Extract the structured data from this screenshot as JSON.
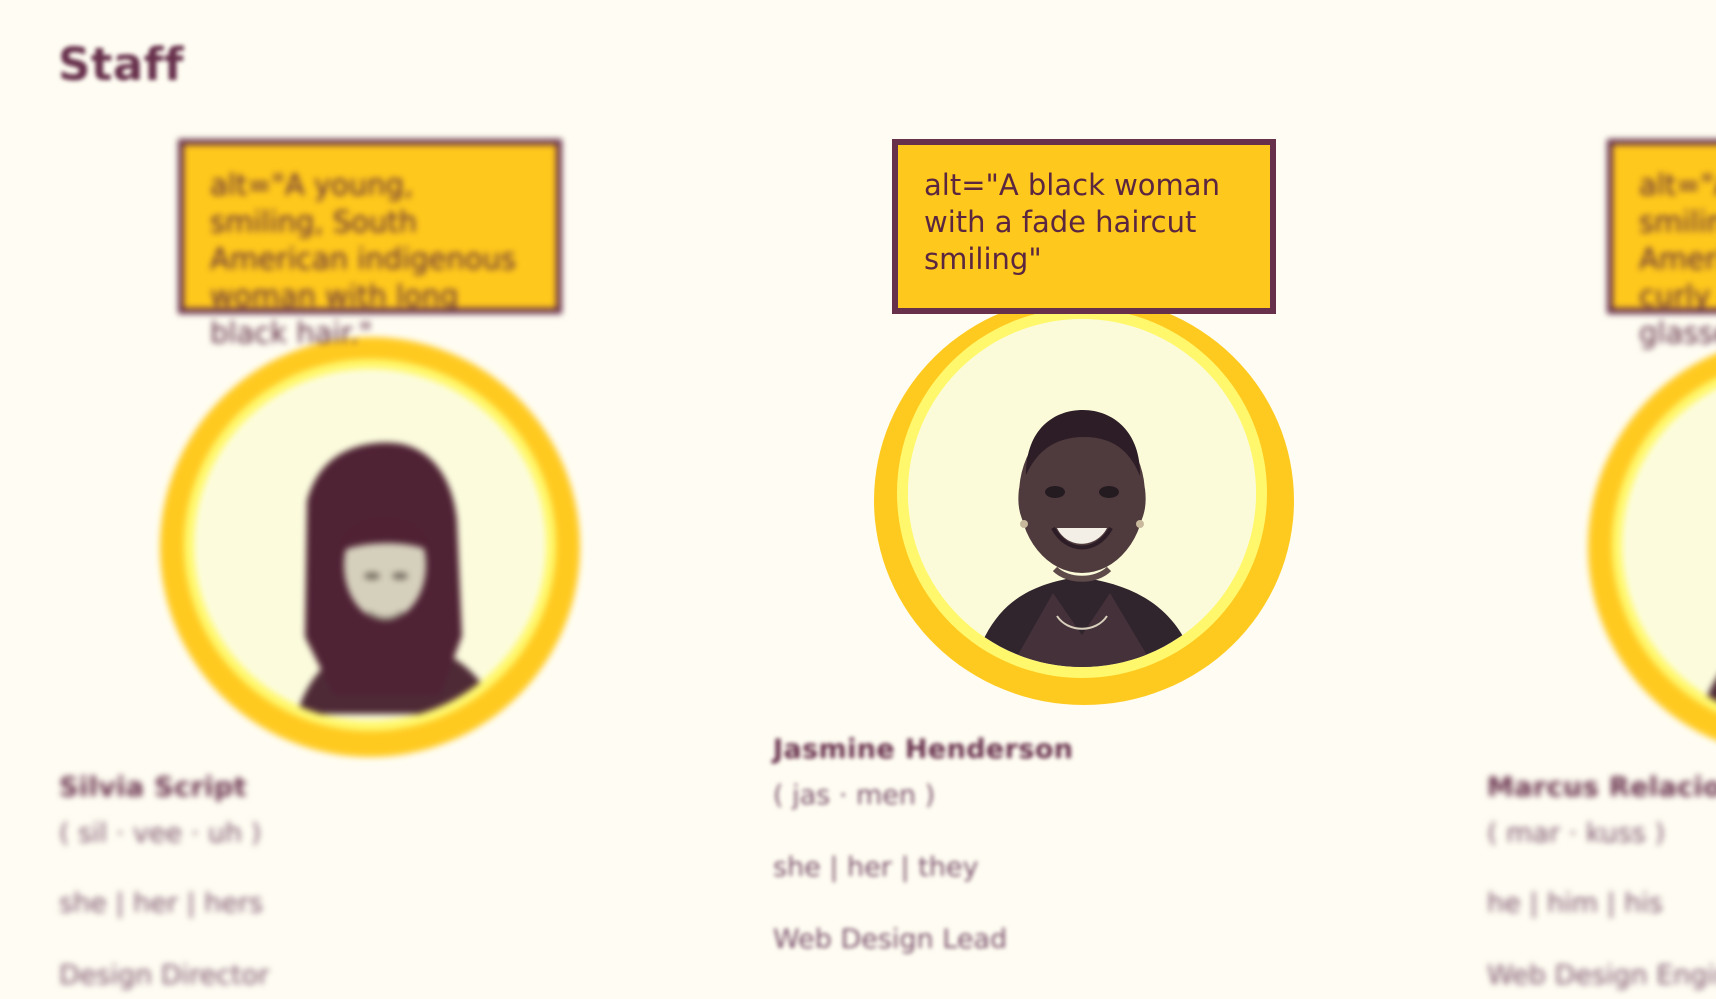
{
  "page": {
    "title": "Staff"
  },
  "staff": [
    {
      "name": "Silvia Script",
      "pronunciation": "( sil · vee · uh )",
      "pronouns": "she | her | hers",
      "role": "Design Director",
      "alt_text": "alt=\"A young, smiling, South American indigenous woman with long black hair.\""
    },
    {
      "name": "Jasmine Henderson",
      "pronunciation": "( jas · men )",
      "pronouns": "she | her | they",
      "role": "Web Design Lead",
      "alt_text": "alt=\"A black woman with a fade haircut smiling\""
    },
    {
      "name": "Marcus Relacion",
      "pronunciation": "( mar · kuss )",
      "pronouns": "he | him | his",
      "role": "Web Design Engineer",
      "alt_text": "alt=\"A young, smiling, South American man with curly afro and glasses\""
    }
  ],
  "colors": {
    "background": "#fffdf3",
    "accent_yellow": "#ffc81c",
    "ring_yellow": "#ffca20",
    "inner_ring": "#fff86d",
    "text_plum": "#67304b"
  },
  "icons": {
    "portrait_placeholder": "person-silhouette-icon"
  }
}
